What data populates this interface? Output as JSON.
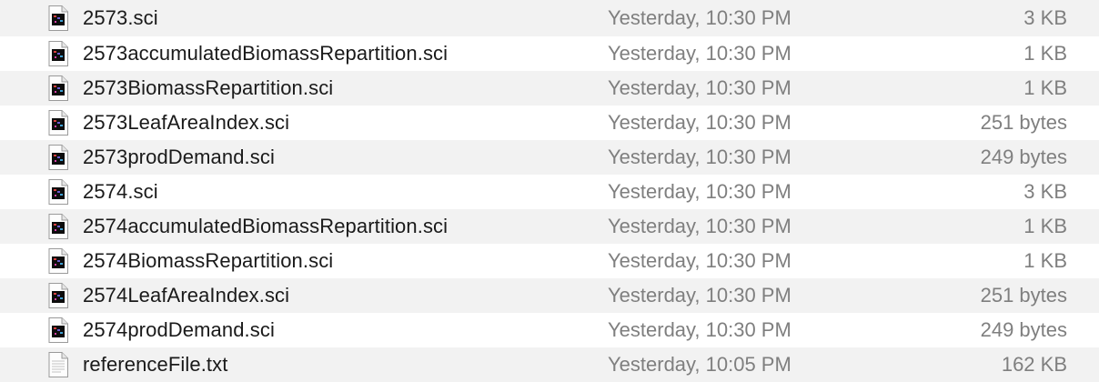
{
  "files": [
    {
      "name": "2573.sci",
      "modified": "Yesterday, 10:30 PM",
      "size": "3 KB",
      "icon": "sci-document-icon"
    },
    {
      "name": "2573accumulatedBiomassRepartition.sci",
      "modified": "Yesterday, 10:30 PM",
      "size": "1 KB",
      "icon": "sci-document-icon"
    },
    {
      "name": "2573BiomassRepartition.sci",
      "modified": "Yesterday, 10:30 PM",
      "size": "1 KB",
      "icon": "sci-document-icon"
    },
    {
      "name": "2573LeafAreaIndex.sci",
      "modified": "Yesterday, 10:30 PM",
      "size": "251 bytes",
      "icon": "sci-document-icon"
    },
    {
      "name": "2573prodDemand.sci",
      "modified": "Yesterday, 10:30 PM",
      "size": "249 bytes",
      "icon": "sci-document-icon"
    },
    {
      "name": "2574.sci",
      "modified": "Yesterday, 10:30 PM",
      "size": "3 KB",
      "icon": "sci-document-icon"
    },
    {
      "name": "2574accumulatedBiomassRepartition.sci",
      "modified": "Yesterday, 10:30 PM",
      "size": "1 KB",
      "icon": "sci-document-icon"
    },
    {
      "name": "2574BiomassRepartition.sci",
      "modified": "Yesterday, 10:30 PM",
      "size": "1 KB",
      "icon": "sci-document-icon"
    },
    {
      "name": "2574LeafAreaIndex.sci",
      "modified": "Yesterday, 10:30 PM",
      "size": "251 bytes",
      "icon": "sci-document-icon"
    },
    {
      "name": "2574prodDemand.sci",
      "modified": "Yesterday, 10:30 PM",
      "size": "249 bytes",
      "icon": "sci-document-icon"
    },
    {
      "name": "referenceFile.txt",
      "modified": "Yesterday, 10:05 PM",
      "size": "162 KB",
      "icon": "text-document-icon"
    }
  ]
}
